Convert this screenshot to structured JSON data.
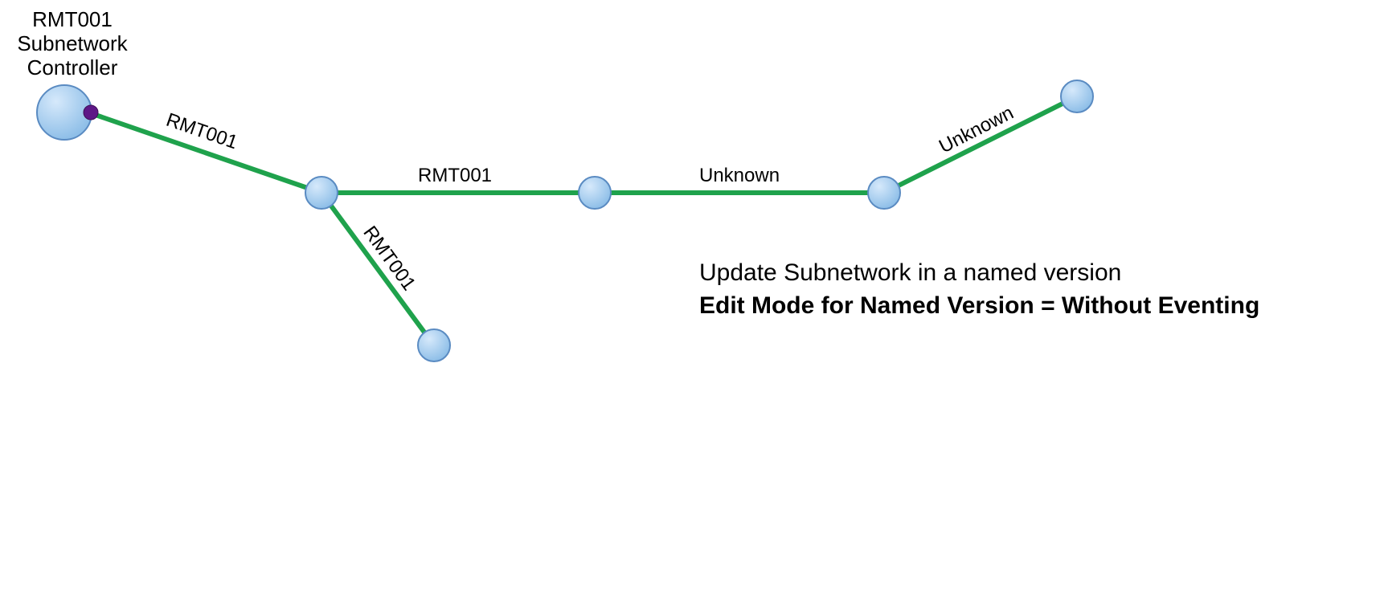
{
  "colors": {
    "node_fill": "#a7cdf0",
    "node_stroke": "#5a8bc2",
    "edge": "#1fa24c",
    "port": "#6a1b9a"
  },
  "nodes": {
    "controller": {
      "label_line1": "RMT001",
      "label_line2": "Subnetwork",
      "label_line3": "Controller"
    },
    "n2": {},
    "n3": {},
    "n4": {},
    "n5": {},
    "n6": {},
    "n7": {}
  },
  "edges": {
    "e1": {
      "label": "RMT001"
    },
    "e2": {
      "label": "RMT001"
    },
    "e3": {
      "label": "RMT001"
    },
    "e4": {
      "label": "Unknown"
    },
    "e5": {
      "label": "Unknown"
    }
  },
  "caption": {
    "line1": "Update Subnetwork in a named version",
    "line2": "Edit Mode for Named Version = Without Eventing"
  }
}
